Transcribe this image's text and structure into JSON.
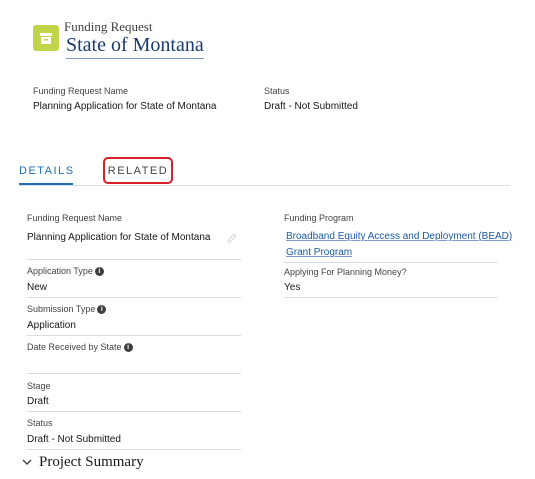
{
  "header": {
    "object_label": "Funding Request",
    "record_title": "State of Montana",
    "icon": "folder-record-icon"
  },
  "highlights": {
    "name_label": "Funding Request Name",
    "name_value": "Planning Application for State of Montana",
    "status_label": "Status",
    "status_value": "Draft - Not Submitted"
  },
  "tabs": {
    "details": "DETAILS",
    "related": "RELATED"
  },
  "details": {
    "left": [
      {
        "label": "Funding Request Name",
        "value": "Planning Application for State of Montana"
      },
      {
        "label": "Application Type",
        "value": "New"
      },
      {
        "label": "Submission Type",
        "value": "Application"
      },
      {
        "label": "Date Received by State",
        "value": ""
      },
      {
        "label": "Stage",
        "value": "Draft"
      },
      {
        "label": "Status",
        "value": "Draft - Not Submitted"
      }
    ],
    "right": [
      {
        "label": "Funding Program",
        "value_line1": "Broadband Equity Access and Deployment (BEAD)",
        "value_line2": "Grant Program"
      },
      {
        "label": "Applying For Planning Money?",
        "value": "Yes"
      }
    ]
  },
  "section": {
    "title": "Project Summary"
  },
  "colors": {
    "accent": "#1f6fb4",
    "icon_bg": "#c2d44a",
    "highlight_border": "#d8202a"
  }
}
